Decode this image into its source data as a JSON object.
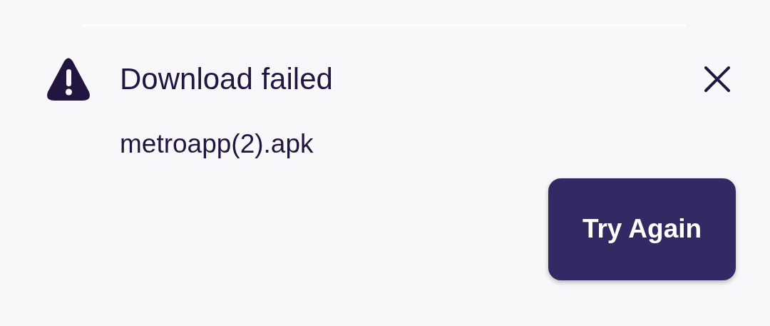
{
  "notification": {
    "title": "Download failed",
    "file_name": "metroapp(2).apk",
    "action": "Try Again"
  }
}
